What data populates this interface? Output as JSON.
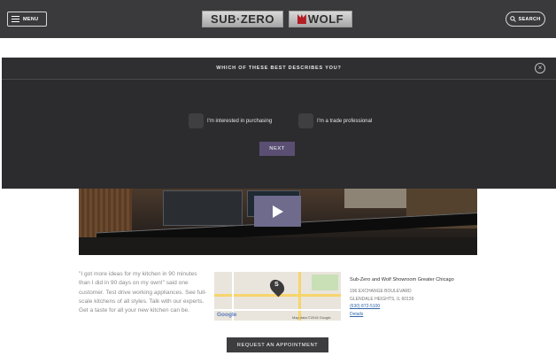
{
  "header": {
    "menu_label": "MENU",
    "search_label": "SEARCH",
    "brand_subzero": "SUB·ZERO",
    "brand_wolf": "WOLF"
  },
  "modal": {
    "title": "WHICH OF THESE BEST DESCRIBES YOU?",
    "close_icon": "close-icon",
    "options": [
      {
        "label": "I'm interested in purchasing"
      },
      {
        "label": "I'm a trade professional"
      }
    ],
    "next_label": "NEXT"
  },
  "hero": {
    "play_icon": "play-icon"
  },
  "content": {
    "quote": "\"I got more ideas for my kitchen in 90 minutes than I did in 90 days on my own!\" said one customer. Test drive working appliances. See full-scale kitchens of all styles. Talk with our experts. Get a taste for all your new kitchen can be.",
    "map": {
      "pin_letter": "S",
      "google": "Google",
      "map_data": "Map data ©2016 Google"
    },
    "showroom": {
      "name": "Sub-Zero and Wolf Showroom Greater Chicago",
      "street": "196 EXCHANGE BOULEVARD",
      "city": "GLENDALE HEIGHTS, IL 60139",
      "phone": "(630) 872-5100",
      "details": "Details"
    },
    "appointment_label": "REQUEST AN APPOINTMENT"
  },
  "colors": {
    "header_bg": "#3a3a3c",
    "modal_bg": "#2c2c2e",
    "accent_purple": "#5a4f73",
    "link_blue": "#3366aa"
  }
}
